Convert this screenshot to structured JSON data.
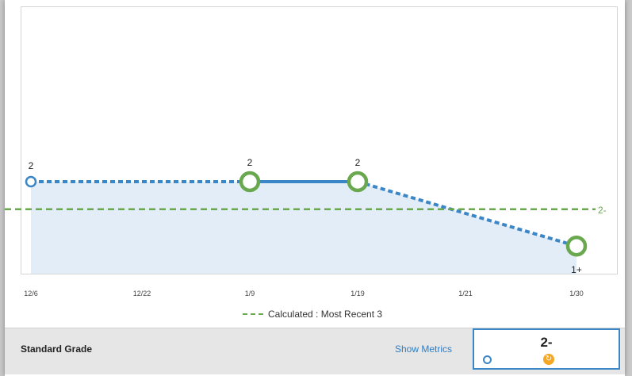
{
  "chart_data": {
    "type": "line",
    "categories": [
      "12/6",
      "12/22",
      "1/9",
      "1/19",
      "1/21",
      "1/30"
    ],
    "series": [
      {
        "points": [
          {
            "x": "12/6",
            "y": 2,
            "label": "2",
            "marker": "blue-hollow"
          },
          {
            "x": "1/9",
            "y": 2,
            "label": "2",
            "marker": "green-hollow"
          },
          {
            "x": "1/19",
            "y": 2,
            "label": "2",
            "marker": "green-hollow"
          },
          {
            "x": "1/30",
            "y": 1.3,
            "label": "1+",
            "marker": "green-hollow"
          }
        ]
      }
    ],
    "calculated": {
      "label": "2-",
      "y": 1.7,
      "legend": "Calculated : Most Recent 3"
    },
    "ylim": [
      1,
      3
    ],
    "colors": {
      "line": "#3a86c6",
      "area": "#e3edf8",
      "marker_green": "#6aa84f",
      "calc_line": "#6aa84f"
    }
  },
  "footer": {
    "standard_grade_label": "Standard Grade",
    "show_metrics_label": "Show Metrics",
    "grade_value": "2-"
  }
}
